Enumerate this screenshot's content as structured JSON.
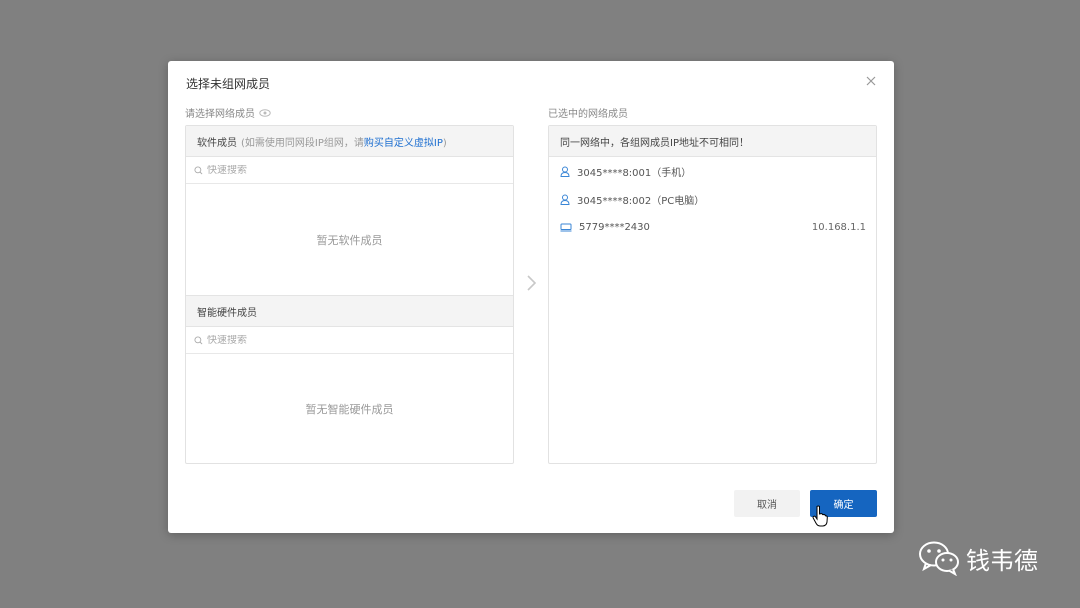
{
  "dialog": {
    "title": "选择未组网成员",
    "left_label": "请选择网络成员",
    "right_label": "已选中的网络成员",
    "software": {
      "header": "软件成员",
      "hint_prefix": "(如需使用同网段IP组网，请",
      "hint_link": "购买自定义虚拟IP",
      "hint_suffix": ")",
      "search_placeholder": "快速搜索",
      "empty_text": "暂无软件成员"
    },
    "hardware": {
      "header": "智能硬件成员",
      "search_placeholder": "快速搜索",
      "empty_text": "暂无智能硬件成员"
    },
    "selected": {
      "notice": "同一网络中，各组网成员IP地址不可相同！",
      "members": [
        {
          "icon": "user-icon",
          "name": "3045****8:001（手机）",
          "ip": ""
        },
        {
          "icon": "user-icon",
          "name": "3045****8:002（PC电脑）",
          "ip": ""
        },
        {
          "icon": "device-icon",
          "name": "5779****2430",
          "ip": "10.168.1.1"
        }
      ]
    },
    "buttons": {
      "cancel": "取消",
      "ok": "确定"
    }
  },
  "watermark": {
    "text": "钱韦德"
  },
  "colors": {
    "accent": "#1565c0",
    "link": "#1e6fd0",
    "backdrop": "#808080"
  }
}
